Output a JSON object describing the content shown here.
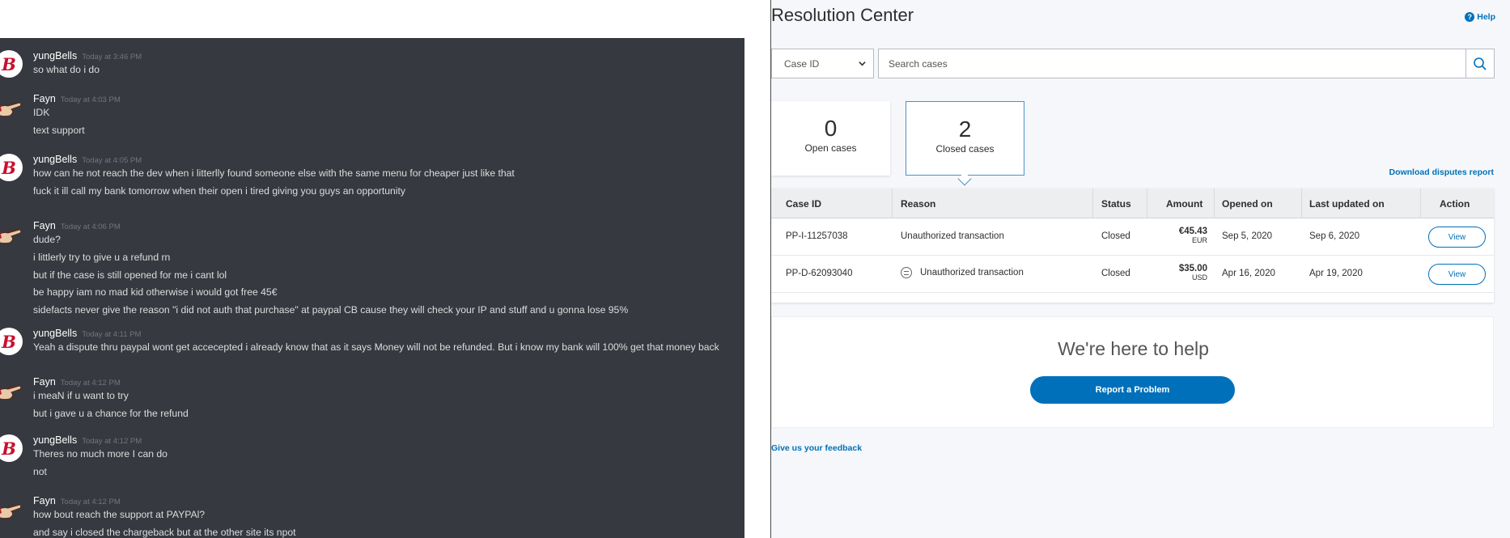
{
  "chat": {
    "groups": [
      {
        "user": "yungBells",
        "time": "Today at 3:46 PM",
        "avatar": "yb",
        "lines": [
          "so what do i do"
        ]
      },
      {
        "user": "Fayn",
        "time": "Today at 4:03 PM",
        "avatar": "fayn",
        "lines": [
          "IDK",
          "text support"
        ]
      },
      {
        "user": "yungBells",
        "time": "Today at 4:05 PM",
        "avatar": "yb",
        "lines": [
          "how can he not reach the dev when i litterlly found someone else with the same menu for cheaper just like that",
          "fuck it ill call my bank tomorrow when their open i tired giving you guys an opportunity"
        ]
      },
      {
        "user": "Fayn",
        "time": "Today at 4:06 PM",
        "avatar": "fayn",
        "lines": [
          "dude?",
          "i littlerly try to give u a refund rn",
          "but if the case is still opened for me i cant lol",
          "be happy iam no mad kid otherwise i would got free 45€",
          "sidefacts never give the reason \"i did not auth that purchase\" at paypal CB cause they will check your IP and stuff and u gonna lose 95%"
        ]
      },
      {
        "user": "yungBells",
        "time": "Today at 4:11 PM",
        "avatar": "yb",
        "lines": [
          "Yeah a dispute thru paypal wont get accecepted i already know that as it says Money will not be refunded. But i know my bank will 100% get that money back"
        ]
      },
      {
        "user": "Fayn",
        "time": "Today at 4:12 PM",
        "avatar": "fayn",
        "lines": [
          "i meaN if u want to try",
          "but i gave u a chance for the refund"
        ]
      },
      {
        "user": "yungBells",
        "time": "Today at 4:12 PM",
        "avatar": "yb",
        "lines": [
          "Theres no much more I can do",
          "not"
        ]
      },
      {
        "user": "Fayn",
        "time": "Today at 4:12 PM",
        "avatar": "fayn",
        "lines": [
          "how bout reach the support at PAYPAl?",
          "and say i closed the chargeback but at the other site its npot"
        ]
      }
    ]
  },
  "rc": {
    "title": "Resolution Center",
    "help": "Help",
    "select_value": "Case ID",
    "search_placeholder": "Search cases",
    "open_count": "0",
    "open_label": "Open cases",
    "closed_count": "2",
    "closed_label": "Closed cases",
    "download": "Download disputes report",
    "headers": [
      "Case ID",
      "Reason",
      "Status",
      "Amount",
      "Opened on",
      "Last updated on",
      "Action"
    ],
    "rows": [
      {
        "case_id": "PP-I-11257038",
        "reason": "Unauthorized transaction",
        "status": "Closed",
        "amount": "€45.43",
        "currency": "EUR",
        "opened": "Sep 5, 2020",
        "updated": "Sep 6, 2020",
        "action": "View",
        "has_message": false
      },
      {
        "case_id": "PP-D-62093040",
        "reason": "Unauthorized transaction",
        "status": "Closed",
        "amount": "$35.00",
        "currency": "USD",
        "opened": "Apr 16, 2020",
        "updated": "Apr 19, 2020",
        "action": "View",
        "has_message": true
      }
    ],
    "help_title": "We're here to help",
    "report_button": "Report a Problem",
    "feedback": "Give us your feedback",
    "colors": {
      "brand_blue": "#0070ba",
      "chat_bg": "#36393f"
    }
  }
}
